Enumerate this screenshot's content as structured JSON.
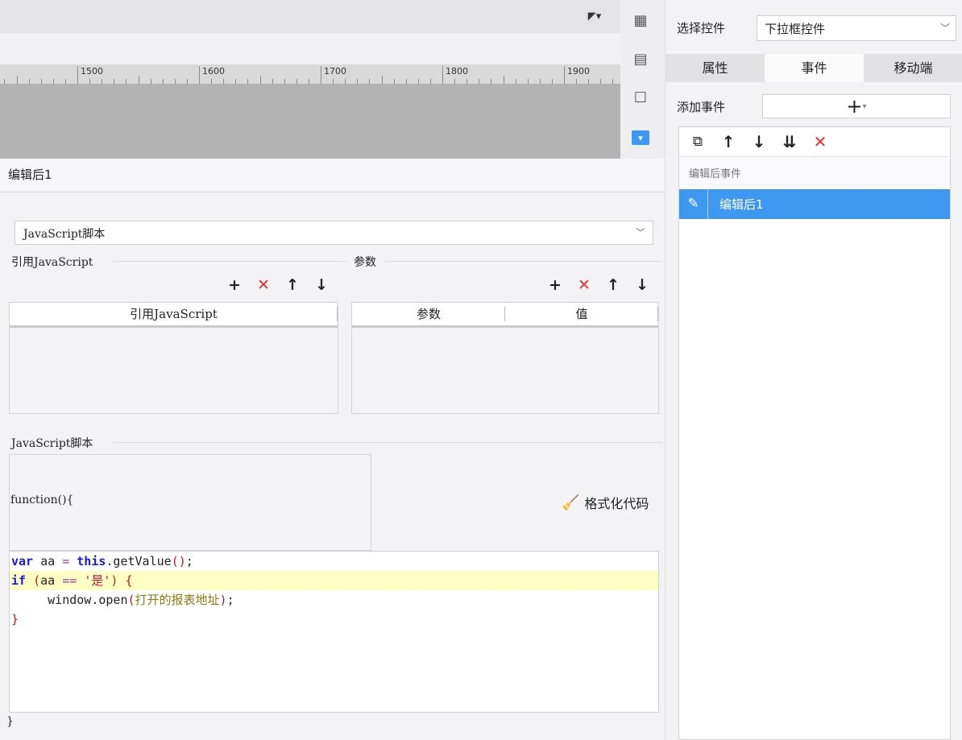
{
  "ruler": {
    "labels": [
      "1500",
      "1600",
      "1700",
      "1800",
      "1900"
    ]
  },
  "toolbar_icons": [
    "layout-icon",
    "table-info-icon",
    "frame-icon",
    "dropdown-widget-icon"
  ],
  "event": {
    "title": "编辑后1",
    "type_value": "JavaScript脚本",
    "ref_js": {
      "group_label": "引用JavaScript",
      "column": "引用JavaScript",
      "rows": []
    },
    "params": {
      "group_label": "参数",
      "columns": [
        "参数",
        "值"
      ],
      "rows": []
    },
    "script": {
      "group_label": "JavaScript脚本",
      "prefix": "function(){",
      "format_label": "格式化代码",
      "suffix": "}",
      "lines": [
        "var aa = this.getValue();",
        "if (aa == '是') {",
        "     window.open(打开的报表地址);",
        "}"
      ],
      "highlighted_line": 2
    }
  },
  "panel": {
    "select_label": "选择控件",
    "select_value": "下拉框控件",
    "tabs": [
      "属性",
      "事件",
      "移动端"
    ],
    "active_tab": "事件",
    "add_event_label": "添加事件",
    "event_group": "编辑后事件",
    "event_item": "编辑后1"
  },
  "colors": {
    "accent": "#3e98f0",
    "delete_red": "#e5312e",
    "highlight": "#ffffc4"
  }
}
